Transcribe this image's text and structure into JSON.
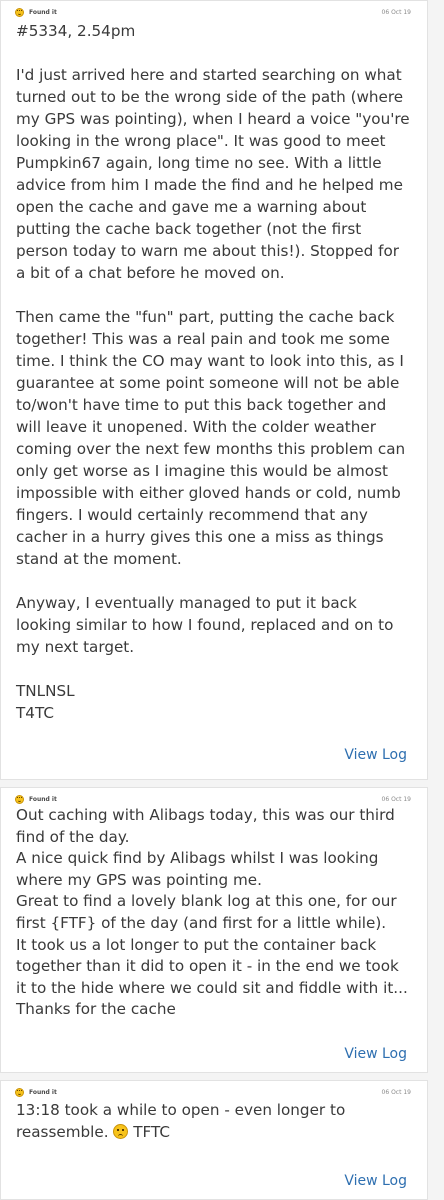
{
  "logs": [
    {
      "type": "Found it",
      "date": "06 Oct 19",
      "paragraphs": [
        "#5334, 2.54pm",
        "I'd just arrived here and started searching on what turned out to be the wrong side of the path (where my GPS was pointing), when I heard a voice \"you're looking in the wrong place\". It was good to meet Pumpkin67 again, long time no see. With a little advice from him I made the find and he helped me open the cache and gave me a warning about putting the cache back together (not the first person today to warn me about this!). Stopped for a bit of a chat before he moved on.",
        "Then came the \"fun\" part, putting the cache back together! This was a real pain and took me some time. I think the CO may want to look into this, as I guarantee at some point someone will not be able to/won't have time to put this back together and will leave it unopened. With the colder weather coming over the next few months this problem can only get worse as I imagine this would be almost impossible with either gloved hands or cold, numb fingers. I would certainly recommend that any cacher in a hurry gives this one a miss as things stand at the moment.",
        "Anyway, I eventually managed to put it back looking similar to how I found, replaced and on to my next target.",
        "TNLNSL\nT4TC"
      ],
      "view_log": "View Log"
    },
    {
      "type": "Found it",
      "date": "06 Oct 19",
      "paragraphs": [
        "Out caching with Alibags today, this was our third find of the day.\nA nice quick find by Alibags whilst I was looking where my GPS was pointing me.\nGreat to find a lovely blank log at this one, for our first {FTF} of the day (and first for a little while).\nIt took us a lot longer to put the container back together than it did to open it - in the end we took it to the hide where we could sit and fiddle with it...\nThanks for the cache"
      ],
      "view_log": "View Log"
    },
    {
      "type": "Found it",
      "date": "06 Oct 19",
      "text_before_emoji": "13:18 took a while to open - even longer to reassemble.",
      "emoji": "confused-face",
      "text_after_emoji": "TFTC",
      "view_log": "View Log"
    }
  ]
}
